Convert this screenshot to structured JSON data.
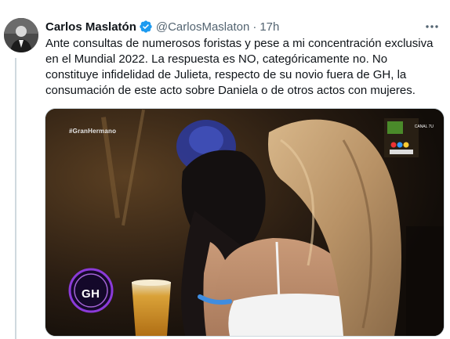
{
  "tweet": {
    "author_name": "Carlos Maslatón",
    "handle": "@CarlosMaslaton",
    "separator": "·",
    "time": "17h",
    "text": "Ante consultas de numerosos foristas y pese a mi concentración exclusiva\nen el Mundial 2022. La respuesta es NO, categóricamente no. No\nconstituye infidelidad de Julieta, respecto de su novio fuera de GH, la\nconsumación de este acto sobre Daniela o de otros actos con mujeres."
  },
  "media": {
    "hashtag": "#GranHermano",
    "logo_text": "GH",
    "channel_label": "CANAL 7U"
  },
  "icons": {
    "verified": "verified-badge-icon",
    "more": "more-options-icon"
  },
  "colors": {
    "verified_blue": "#1d9bf0",
    "secondary_text": "#536471",
    "thread_line": "#cfd9de"
  }
}
